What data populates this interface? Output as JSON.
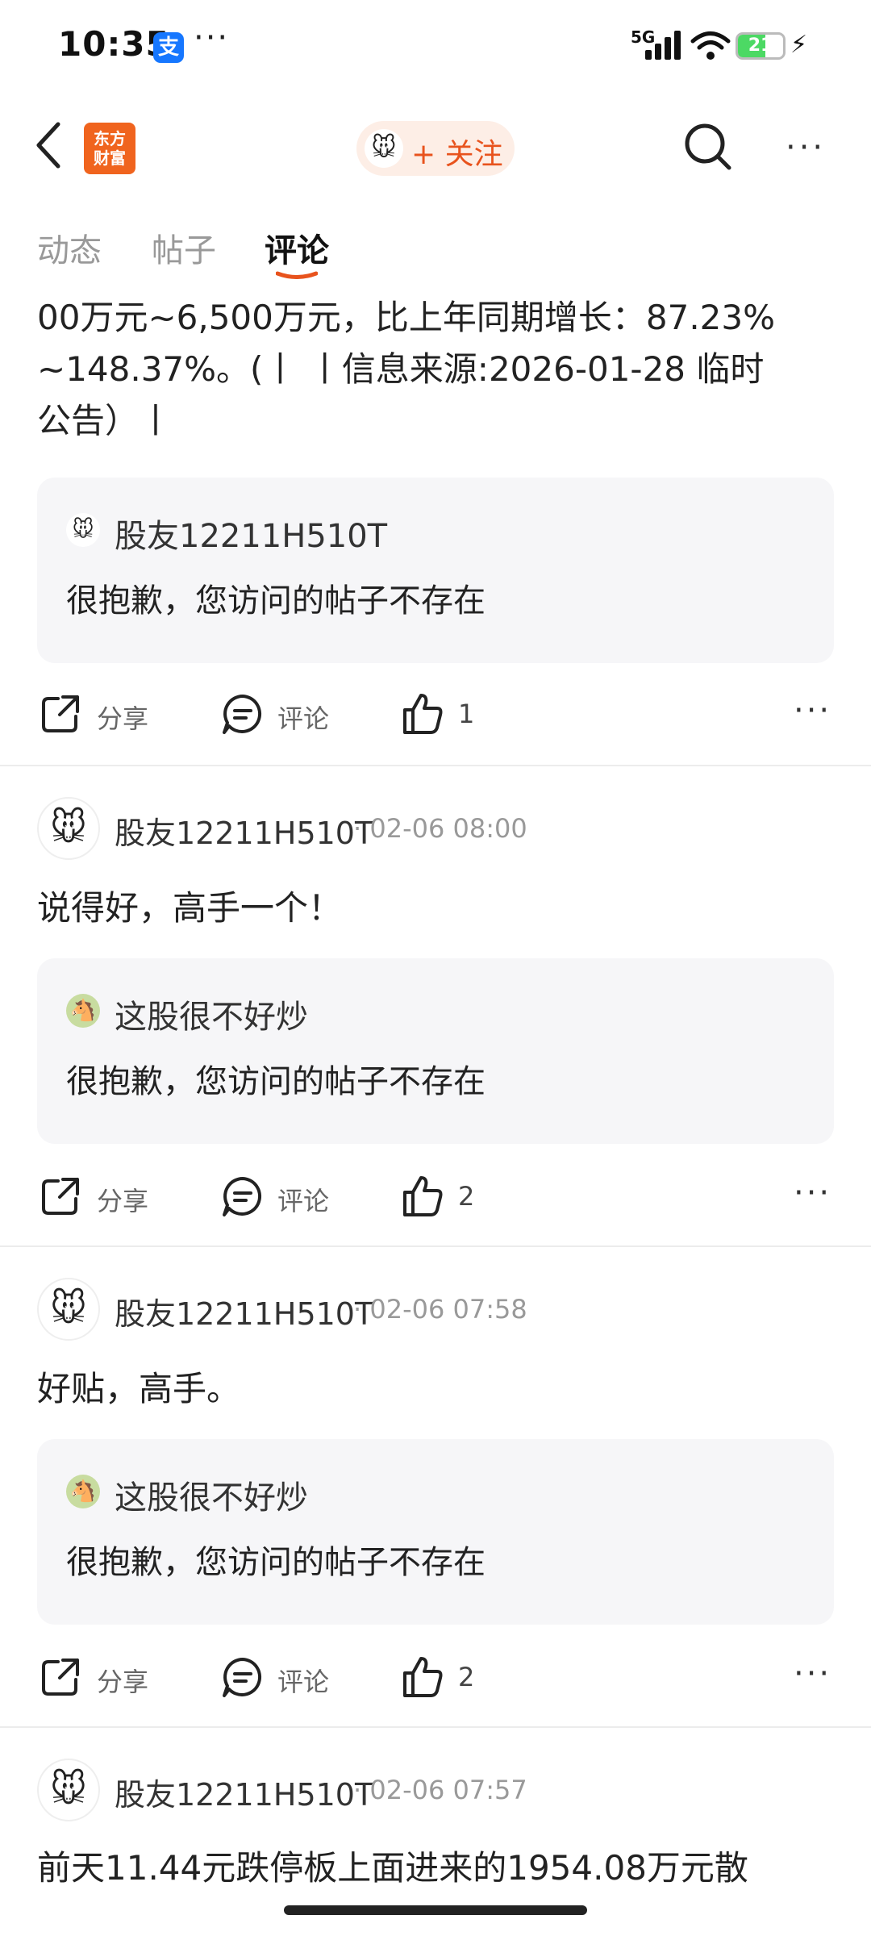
{
  "status_bar": {
    "time": "10:35",
    "alipay": "支",
    "dots": "···",
    "network": "5G",
    "battery": "21"
  },
  "nav": {
    "logo_line1": "东方",
    "logo_line2": "财富",
    "follow_label": "+ 关注",
    "more": "···"
  },
  "tabs": [
    {
      "label": "动态"
    },
    {
      "label": "帖子"
    },
    {
      "label": "评论"
    }
  ],
  "post": {
    "lines": [
      "00万元~6,500万元，比上年同期增长：87.23%",
      "~148.37%。(丨 丨信息来源:2026-01-28 临时",
      "公告）丨"
    ],
    "quote": {
      "author": "股友12211H510T",
      "body": "很抱歉，您访问的帖子不存在"
    },
    "actions": {
      "share": "分享",
      "comment": "评论",
      "likes": "1",
      "more": "···"
    }
  },
  "comments": [
    {
      "author": "股友12211H510T",
      "time": "· 02-06 08:00",
      "text": "说得好，高手一个！",
      "quote": {
        "author": "这股很不好炒",
        "body": "很抱歉，您访问的帖子不存在"
      },
      "actions": {
        "share": "分享",
        "comment": "评论",
        "likes": "2",
        "more": "···"
      }
    },
    {
      "author": "股友12211H510T",
      "time": "· 02-06 07:58",
      "text": "好贴，高手。",
      "quote": {
        "author": "这股很不好炒",
        "body": "很抱歉，您访问的帖子不存在"
      },
      "actions": {
        "share": "分享",
        "comment": "评论",
        "likes": "2",
        "more": "···"
      }
    },
    {
      "author": "股友12211H510T",
      "time": "· 02-06 07:57",
      "text": "前天11.44元跌停板上面进来的1954.08万元散"
    }
  ],
  "colors": {
    "accent": "#e8531d",
    "logo": "#f0641e",
    "quote_bg": "#f6f6f8"
  },
  "icons": {
    "share": "share-icon",
    "comment": "comment-icon",
    "like": "thumbs-up-icon",
    "search": "search-icon",
    "back": "back-arrow-icon"
  }
}
